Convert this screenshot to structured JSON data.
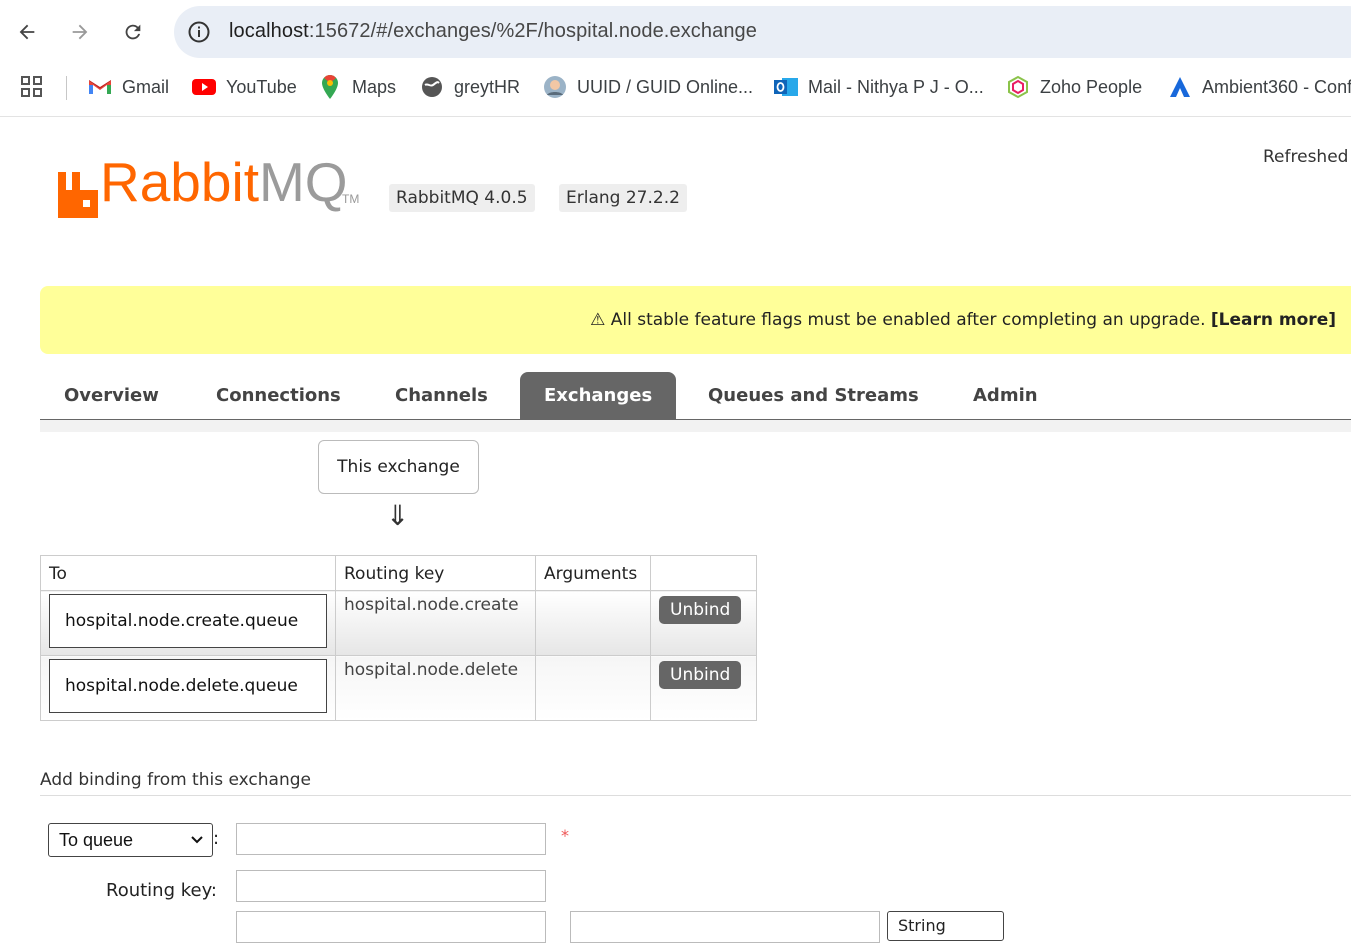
{
  "browser": {
    "url_host": "localhost",
    "url_rest": ":15672/#/exchanges/%2F/hospital.node.exchange",
    "bookmarks": [
      {
        "label": "Gmail",
        "icon": "gmail-icon"
      },
      {
        "label": "YouTube",
        "icon": "youtube-icon"
      },
      {
        "label": "Maps",
        "icon": "maps-icon"
      },
      {
        "label": "greytHR",
        "icon": "greythr-icon"
      },
      {
        "label": "UUID / GUID Online...",
        "icon": "uuid-icon"
      },
      {
        "label": "Mail - Nithya P J - O...",
        "icon": "outlook-icon"
      },
      {
        "label": "Zoho People",
        "icon": "zoho-icon"
      },
      {
        "label": "Ambient360 - Conf",
        "icon": "ambient-icon"
      }
    ]
  },
  "header": {
    "logo_r": "Rabbit",
    "logo_mq": "MQ",
    "tm": "TM",
    "rabbitmq_version": "RabbitMQ 4.0.5",
    "erlang_version": "Erlang 27.2.2",
    "refreshed": "Refreshed"
  },
  "banner": {
    "icon": "⚠",
    "message": "All stable feature flags must be enabled after completing an upgrade.",
    "link": "[Learn more]"
  },
  "tabs": [
    {
      "label": "Overview"
    },
    {
      "label": "Connections"
    },
    {
      "label": "Channels"
    },
    {
      "label": "Exchanges",
      "active": true
    },
    {
      "label": "Queues and Streams"
    },
    {
      "label": "Admin"
    }
  ],
  "bindings": {
    "this_exchange": "This exchange",
    "arrow": "⇓",
    "headers": [
      "To",
      "Routing key",
      "Arguments",
      ""
    ],
    "rows": [
      {
        "to": "hospital.node.create.queue",
        "routing_key": "hospital.node.create",
        "arguments": "",
        "action": "Unbind"
      },
      {
        "to": "hospital.node.delete.queue",
        "routing_key": "hospital.node.delete",
        "arguments": "",
        "action": "Unbind"
      }
    ]
  },
  "add_binding": {
    "title": "Add binding from this exchange",
    "destination_type": "To queue",
    "colon": ":",
    "required_mark": "*",
    "routing_key_label": "Routing key:",
    "arg_type": "String"
  },
  "colors": {
    "brand": "#ff6600",
    "banner_bg": "#ffff99",
    "tab_active_bg": "#666666",
    "button_bg": "#666666"
  }
}
